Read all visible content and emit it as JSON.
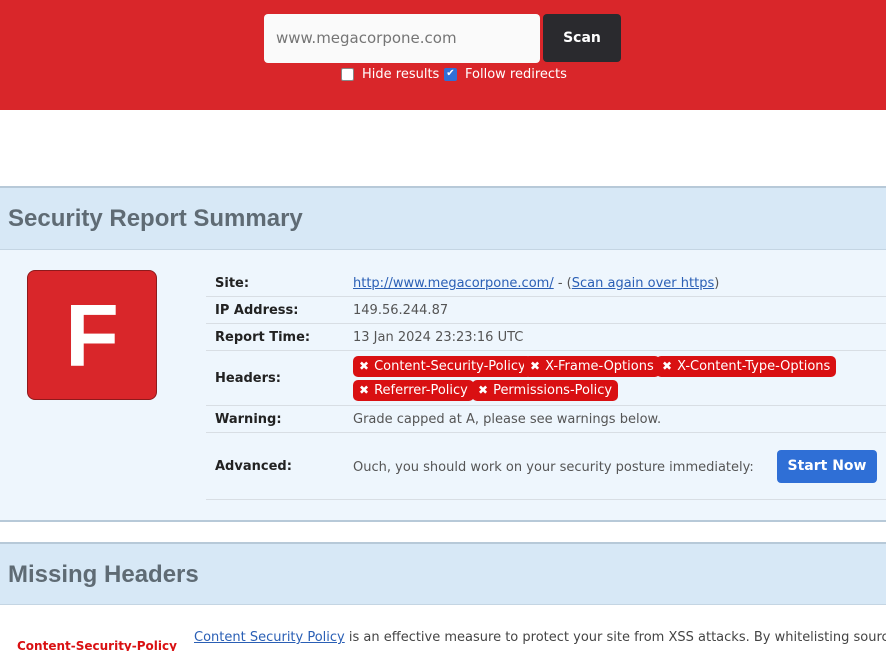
{
  "search": {
    "placeholder": "www.megacorpone.com",
    "scan_label": "Scan",
    "hide_results_label": "Hide results",
    "hide_results_checked": false,
    "follow_redirects_label": "Follow redirects",
    "follow_redirects_checked": true
  },
  "summary": {
    "title": "Security Report Summary",
    "grade": "F",
    "site_label": "Site:",
    "site_url": "http://www.megacorpone.com/",
    "site_sep": " - (",
    "site_rescan": "Scan again over https",
    "site_close": ")",
    "ip_label": "IP Address:",
    "ip_value": "149.56.244.87",
    "time_label": "Report Time:",
    "time_value": "13 Jan 2024 23:23:16 UTC",
    "headers_label": "Headers:",
    "headers": [
      "Content-Security-Policy",
      "X-Frame-Options",
      "X-Content-Type-Options",
      "Referrer-Policy",
      "Permissions-Policy"
    ],
    "warning_label": "Warning:",
    "warning_value": "Grade capped at A, please see warnings below.",
    "advanced_label": "Advanced:",
    "advanced_value": "Ouch, you should work on your security posture immediately:",
    "start_label": "Start Now"
  },
  "missing": {
    "title": "Missing Headers",
    "first_name": "Content-Security-Policy",
    "first_link": "Content Security Policy",
    "first_desc": " is an effective measure to protect your site from XSS attacks. By whitelisting sources of"
  },
  "colors": {
    "brand_red": "#d9262a",
    "header_badge_red": "#d91012",
    "accent_blue": "#2f6fd6",
    "section_blue": "#d7e8f6"
  },
  "icons": {
    "header_missing": "x-icon",
    "checkbox_checked": "check-icon"
  }
}
